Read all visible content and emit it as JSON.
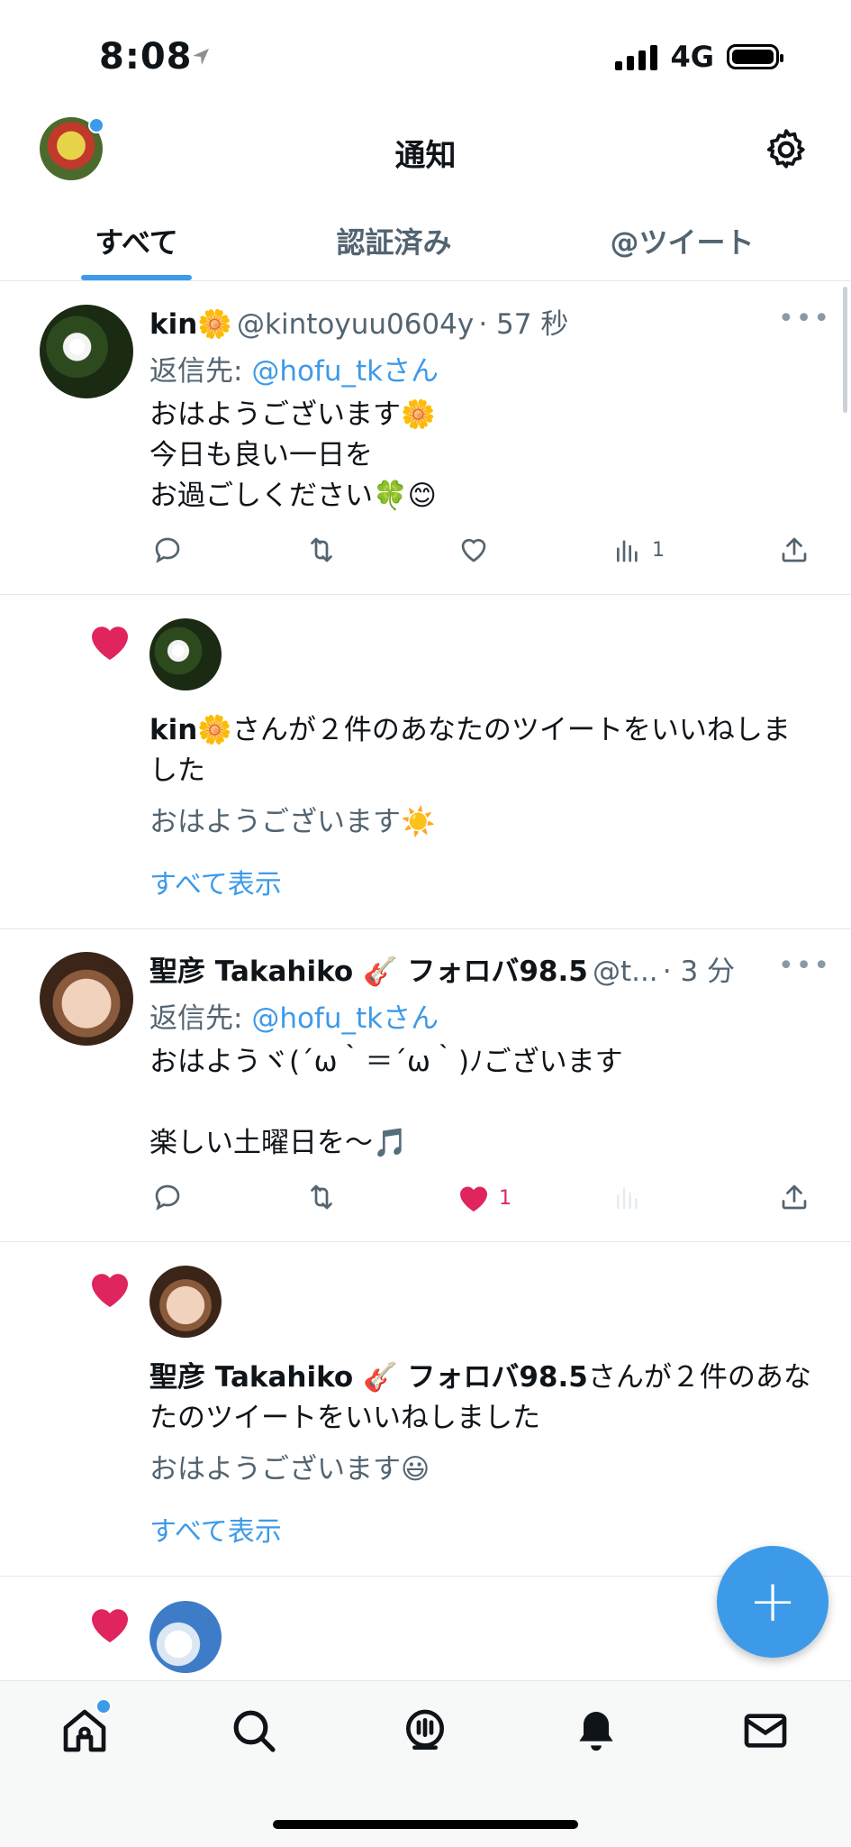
{
  "status_bar": {
    "time": "8:08",
    "network": "4G"
  },
  "header": {
    "title": "通知"
  },
  "tabs": [
    {
      "label": "すべて",
      "active": true
    },
    {
      "label": "認証済み",
      "active": false
    },
    {
      "label": "@ツイート",
      "active": false
    }
  ],
  "feed": [
    {
      "type": "tweet",
      "name": "kin🌼",
      "handle": "@kintoyuu0604y",
      "time": "· 57 秒",
      "reply_prefix": "返信先: ",
      "reply_to": "@hofu_tk",
      "reply_suffix": "さん",
      "body": "おはようございます🌼\n今日も良い一日を\nお過ごしください🍀😊",
      "views": "1"
    },
    {
      "type": "like",
      "actor": "kin🌼",
      "text": "さんが２件のあなたのツイートをいいねしました",
      "preview": "おはようございます☀️",
      "show_all": "すべて表示"
    },
    {
      "type": "tweet",
      "name": "聖彦 Takahiko 🎸 フォロバ98.5",
      "handle": "@t...",
      "time": "· 3 分",
      "reply_prefix": "返信先: ",
      "reply_to": "@hofu_tk",
      "reply_suffix": "さん",
      "body": "おはようヾ(´ω｀＝´ω｀)ﾉございます\n\n楽しい土曜日を〜🎵",
      "likes": "1"
    },
    {
      "type": "like",
      "actor": "聖彦 Takahiko 🎸 フォロバ98.5",
      "text": "さんが２件のあなたのツイートをいいねしました",
      "preview": "おはようございます😃",
      "show_all": "すべて表示"
    }
  ],
  "fab": {
    "label": "+"
  },
  "colors": {
    "accent": "#3d9ae8",
    "like": "#e0245e",
    "muted": "#536471"
  },
  "nav_icons": [
    "home-icon",
    "search-icon",
    "spaces-icon",
    "notifications-icon",
    "messages-icon"
  ]
}
